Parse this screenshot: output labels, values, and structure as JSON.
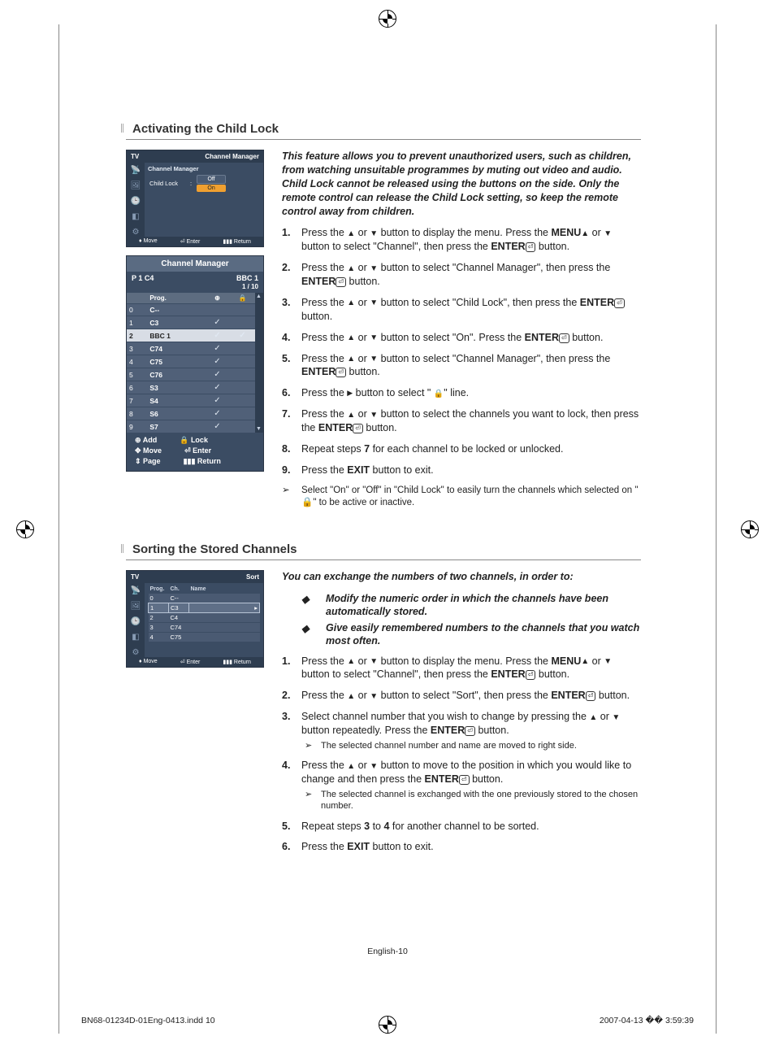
{
  "section1": {
    "title": "Activating the Child Lock",
    "intro": "This feature allows you to prevent unauthorized users, such as children, from watching unsuitable programmes by muting out video and audio. Child Lock cannot be released using the buttons on the side. Only the remote control can release the Child Lock setting, so keep the remote control away from children.",
    "steps": [
      {
        "pre": "Press the ",
        "b1": "MENU",
        "mid": " button to display the menu.  Press the ",
        "icons": "updown",
        "mid2": "  button to select \"Channel\", then press the ",
        "b2": "ENTER",
        "post": " button."
      },
      {
        "pre": "Press the ",
        "icons": "updown",
        "mid": " button to select \"Channel Manager\", then press the ",
        "b1": "ENTER",
        "post": " button."
      },
      {
        "pre": "Press the ",
        "icons": "updown",
        "mid": " button to select \"Child Lock\", then press the ",
        "b1": "ENTER",
        "post": " button."
      },
      {
        "pre": "Press the ",
        "icons": "updown",
        "mid": " button to select \"On\". Press the ",
        "b1": "ENTER",
        "post": " button."
      },
      {
        "pre": "Press the ",
        "icons": "updown",
        "mid": " button to select \"Channel Manager\", then press the ",
        "b1": "ENTER",
        "post": " button."
      },
      {
        "pre": "Press the ",
        "icons": "right",
        "mid": " button to select \" ",
        "lock": true,
        "post": "\" line."
      },
      {
        "pre": "Press the ",
        "icons": "updown",
        "mid": " button to select the channels you want to lock, then press the ",
        "b1": "ENTER",
        "post": " button."
      },
      {
        "plain": "Repeat steps ",
        "b1": "7",
        "post": " for each channel to be locked or unlocked."
      },
      {
        "plain": "Press the ",
        "b1": "EXIT",
        "post": " button to exit."
      }
    ],
    "note": "Select \"On\" or \"Off\" in \"Child Lock\" to easily turn the channels which selected on \" 🔒\" to be active or inactive.",
    "tv_small": {
      "tv_label": "TV",
      "header": "Channel Manager",
      "panel_title": "Channel Manager",
      "row_label": "Child Lock",
      "opt_off": "Off",
      "opt_on": "On",
      "footer_move": "Move",
      "footer_enter": "Enter",
      "footer_return": "Return"
    },
    "ch_mgr": {
      "title": "Channel Manager",
      "top_left": "P 1   C4",
      "top_right": "BBC 1",
      "pager": "1 / 10",
      "col_prog": "Prog.",
      "rows": [
        {
          "n": "0",
          "ch": "C--",
          "check": false,
          "lock": false,
          "sel": false
        },
        {
          "n": "1",
          "ch": "C3",
          "check": true,
          "lock": false,
          "sel": false
        },
        {
          "n": "2",
          "ch": "BBC 1",
          "check": true,
          "lock": true,
          "sel": true
        },
        {
          "n": "3",
          "ch": "C74",
          "check": true,
          "lock": false,
          "sel": false
        },
        {
          "n": "4",
          "ch": "C75",
          "check": true,
          "lock": false,
          "sel": false
        },
        {
          "n": "5",
          "ch": "C76",
          "check": true,
          "lock": false,
          "sel": false
        },
        {
          "n": "6",
          "ch": "S3",
          "check": true,
          "lock": false,
          "sel": false
        },
        {
          "n": "7",
          "ch": "S4",
          "check": true,
          "lock": false,
          "sel": false
        },
        {
          "n": "8",
          "ch": "S6",
          "check": true,
          "lock": false,
          "sel": false
        },
        {
          "n": "9",
          "ch": "S7",
          "check": true,
          "lock": false,
          "sel": false
        }
      ],
      "footer_add": "Add",
      "footer_lock": "Lock",
      "footer_move": "Move",
      "footer_enter": "Enter",
      "footer_page": "Page",
      "footer_return": "Return"
    }
  },
  "section2": {
    "title": "Sorting the Stored Channels",
    "intro": "You can exchange the numbers of two channels, in order to:",
    "bullets": [
      "Modify the numeric order in which the channels have been automatically stored.",
      "Give easily remembered numbers to the channels that you watch most often."
    ],
    "steps": [
      {
        "pre": "Press the ",
        "b1": "MENU",
        "mid": " button to display the menu.  Press the ",
        "icons": "updown",
        "mid2": "  button to select \"Channel\", then press the ",
        "b2": "ENTER",
        "post": " button."
      },
      {
        "pre": "Press the ",
        "icons": "updown",
        "mid": " button to select \"Sort\", then press the ",
        "b1": "ENTER",
        "post": " button."
      },
      {
        "plain": "Select channel number that you wish to change by pressing the ",
        "icons": "updown",
        "mid": " button repeatedly. Press the ",
        "b1": "ENTER",
        "post": " button.",
        "sub": "The selected channel number and name are moved to right side."
      },
      {
        "pre": "Press the ",
        "icons": "updown",
        "mid": " button to move to the position in which you would like to change and then press the  ",
        "b1": "ENTER",
        "post": " button.",
        "sub": "The selected channel is exchanged with the one previously stored to the chosen number."
      },
      {
        "plain": "Repeat steps ",
        "b1": "3",
        "mid": " to ",
        "b2": "4",
        "post": " for another channel to be sorted."
      },
      {
        "plain": "Press the ",
        "b1": "EXIT",
        "post": " button to exit."
      }
    ],
    "tv_small": {
      "tv_label": "TV",
      "header": "Sort",
      "col_prog": "Prog.",
      "col_ch": "Ch.",
      "col_name": "Name",
      "rows": [
        {
          "p": "0",
          "c": "C--",
          "n": ""
        },
        {
          "p": "1",
          "c": "C3",
          "n": "",
          "hl": true
        },
        {
          "p": "2",
          "c": "C4",
          "n": ""
        },
        {
          "p": "3",
          "c": "C74",
          "n": ""
        },
        {
          "p": "4",
          "c": "C75",
          "n": ""
        }
      ],
      "footer_move": "Move",
      "footer_enter": "Enter",
      "footer_return": "Return"
    }
  },
  "folio_center": "English-10",
  "folio_left": "BN68-01234D-01Eng-0413.indd   10",
  "folio_right": "2007-04-13   �� 3:59:39"
}
